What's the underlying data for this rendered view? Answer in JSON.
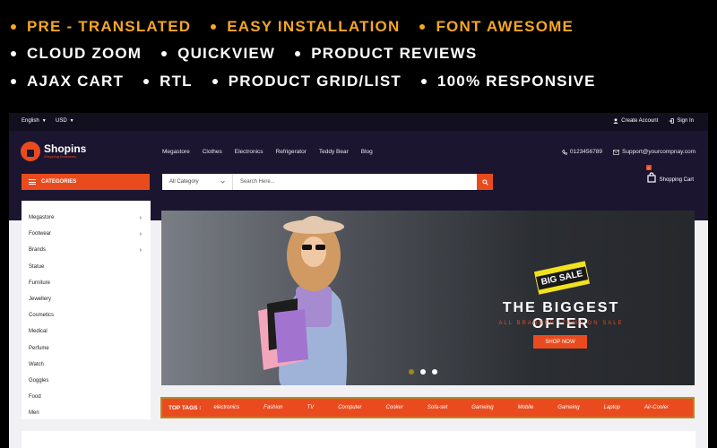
{
  "features": {
    "row1": [
      "PRE - TRANSLATED",
      "EASY INSTALLATION",
      "FONT AWESOME"
    ],
    "row2": [
      "CLOUD ZOOM",
      "QUICKVIEW",
      "PRODUCT REVIEWS"
    ],
    "row3": [
      "AJAX CART",
      "RTL",
      "PRODUCT GRID/LIST",
      "100% RESPONSIVE"
    ],
    "accent_color": "#f5a623"
  },
  "topbar": {
    "language": "English",
    "currency": "USD",
    "create_account": "Create Account",
    "sign_in": "Sign In"
  },
  "header": {
    "logo_title": "Shopins",
    "logo_tagline": "Shopping Accessory",
    "menu": [
      "Megastore",
      "Clothes",
      "Electronics",
      "Refrigerator",
      "Teddy Bear",
      "Blog"
    ],
    "phone": "0123456789",
    "email": "Support@yourcompnay.com",
    "categories_label": "CATEGORIES",
    "search_category": "All Category",
    "search_placeholder": "Search Here...",
    "cart_label": "Shopping Cart",
    "cart_count": "0",
    "brand_color": "#ea4b1e"
  },
  "sidebar": {
    "items": [
      {
        "label": "Megastore",
        "arrow": "›"
      },
      {
        "label": "Footwear",
        "arrow": "›"
      },
      {
        "label": "Brands",
        "arrow": "›"
      },
      {
        "label": "Statue",
        "arrow": ""
      },
      {
        "label": "Furniture",
        "arrow": ""
      },
      {
        "label": "Jewellery",
        "arrow": ""
      },
      {
        "label": "Cosmetics",
        "arrow": ""
      },
      {
        "label": "Medical",
        "arrow": ""
      },
      {
        "label": "Perfume",
        "arrow": ""
      },
      {
        "label": "Watch",
        "arrow": ""
      },
      {
        "label": "Goggles",
        "arrow": ""
      },
      {
        "label": "Food",
        "arrow": ""
      },
      {
        "label": "Men",
        "arrow": ""
      }
    ]
  },
  "hero": {
    "badge": "BIG SALE",
    "title": "THE BIGGEST OFFER",
    "subtitle": "ALL BRANDED ITEMS ON SALE",
    "button": "SHOP NOW",
    "active_slide": 1,
    "slide_count": 3
  },
  "tags": {
    "label": "TOP TAGS :",
    "items": [
      "electronics",
      "Fashion",
      "TV",
      "Computer",
      "Cooker",
      "Sofa-set",
      "Gameing",
      "Mobile",
      "Gameing",
      "Laptop",
      "Air-Cooler"
    ]
  }
}
